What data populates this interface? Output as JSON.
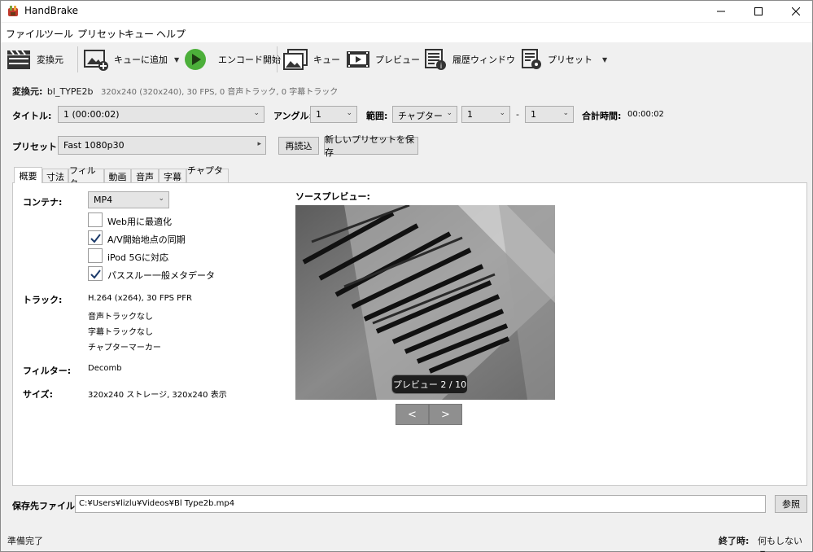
{
  "window": {
    "title": "HandBrake"
  },
  "menu": [
    "ファイル",
    "ツール",
    "プリセット",
    "キュー",
    "ヘルプ"
  ],
  "toolbar": {
    "source": "変換元",
    "add_queue": "キューに追加",
    "start_encode": "エンコード開始",
    "queue": "キュー",
    "preview": "プレビュー",
    "activity": "履歴ウィンドウ",
    "presets": "プリセット"
  },
  "source": {
    "label": "変換元:",
    "name": "bl_TYPE2b",
    "info": "320x240 (320x240), 30 FPS, 0 音声トラック, 0 字幕トラック"
  },
  "title_row": {
    "title_label": "タイトル:",
    "title_value": "1  (00:00:02)",
    "angle_label": "アングル:",
    "angle_value": "1",
    "range_label": "範囲:",
    "range_type": "チャプター",
    "range_start": "1",
    "range_dash": "-",
    "range_end": "1",
    "duration_label": "合計時間:",
    "duration_value": "00:00:02"
  },
  "preset_row": {
    "label": "プリセット:",
    "value": "Fast 1080p30",
    "reload": "再読込",
    "save_new": "新しいプリセットを保存"
  },
  "tabs": [
    "概要",
    "寸法",
    "フィルタ",
    "動画",
    "音声",
    "字幕",
    "チャプター"
  ],
  "summary": {
    "container_label": "コンテナ:",
    "container_value": "MP4",
    "options": [
      {
        "label": "Web用に最適化",
        "checked": false
      },
      {
        "label": "A/V開始地点の同期",
        "checked": true
      },
      {
        "label": "iPod 5Gに対応",
        "checked": false
      },
      {
        "label": "パススルー一般メタデータ",
        "checked": true
      }
    ],
    "tracks_label": "トラック:",
    "tracks": [
      "H.264 (x264), 30 FPS PFR",
      "音声トラックなし",
      "字幕トラックなし",
      "チャプターマーカー"
    ],
    "filters_label": "フィルター:",
    "filters_value": "Decomb",
    "size_label": "サイズ:",
    "size_value": "320x240 ストレージ, 320x240 表示"
  },
  "preview": {
    "label": "ソースプレビュー:",
    "badge": "プレビュー 2 / 10",
    "prev": "<",
    "next": ">"
  },
  "destination": {
    "label": "保存先ファイル:",
    "path": "C:¥Users¥lizlu¥Videos¥Bl Type2b.mp4",
    "browse": "参照"
  },
  "status": {
    "text": "準備完了",
    "when_done_label": "終了時:",
    "when_done_value": "何もしない"
  }
}
